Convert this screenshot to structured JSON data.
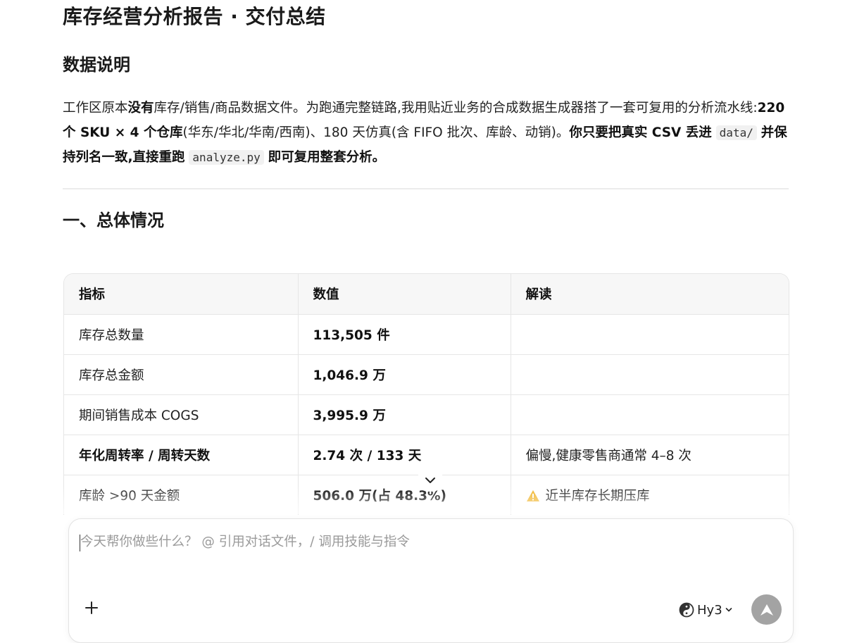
{
  "report": {
    "title": "库存经营分析报告 · 交付总结",
    "data_section": {
      "heading": "数据说明",
      "p1": "工作区原本",
      "p2": "没有",
      "p3": "库存/销售/商品数据文件。为跑通完整链路,我用贴近业务的合成数据生成器搭了一套可复用的分析流水线:",
      "p4": "220 个 SKU × 4 个仓库",
      "p5": "(华东/华北/华南/西南)、180 天仿真(含 FIFO 批次、库龄、动销)。",
      "p6": "你只要把真实 CSV 丢进",
      "code1": "data/",
      "p7": "并保持列名一致,直接重跑",
      "code2": "analyze.py",
      "p8": "即可复用整套分析。"
    },
    "overview_section": {
      "heading": "一、总体情况",
      "table": {
        "headers": [
          "指标",
          "数值",
          "解读"
        ],
        "rows": [
          {
            "metric": "库存总数量",
            "value": "113,505 件",
            "note": ""
          },
          {
            "metric": "库存总金额",
            "value": "1,046.9 万",
            "note": ""
          },
          {
            "metric": "期间销售成本 COGS",
            "value": "3,995.9 万",
            "note": ""
          },
          {
            "metric": "年化周转率 / 周转天数",
            "value": "2.74 次 / 133 天",
            "note": "偏慢,健康零售商通常 4–8 次"
          },
          {
            "metric": "库龄 >90 天金额",
            "value": "506.0 万(占 48.3%)",
            "note": "近半库存长期压库"
          }
        ]
      }
    }
  },
  "composer": {
    "placeholder": "今天帮你做些什么？ @ 引用对话文件，/ 调用技能与指令",
    "model_label": "Hy3"
  },
  "icons": {
    "scroll": "chevron-down-icon",
    "warning": "warning-icon",
    "add": "plus-icon",
    "model": "hunyuan-logo-icon",
    "send": "arrow-up-icon"
  },
  "colors": {
    "send_button": "#a3a3a3",
    "warning": "#f0b429"
  }
}
